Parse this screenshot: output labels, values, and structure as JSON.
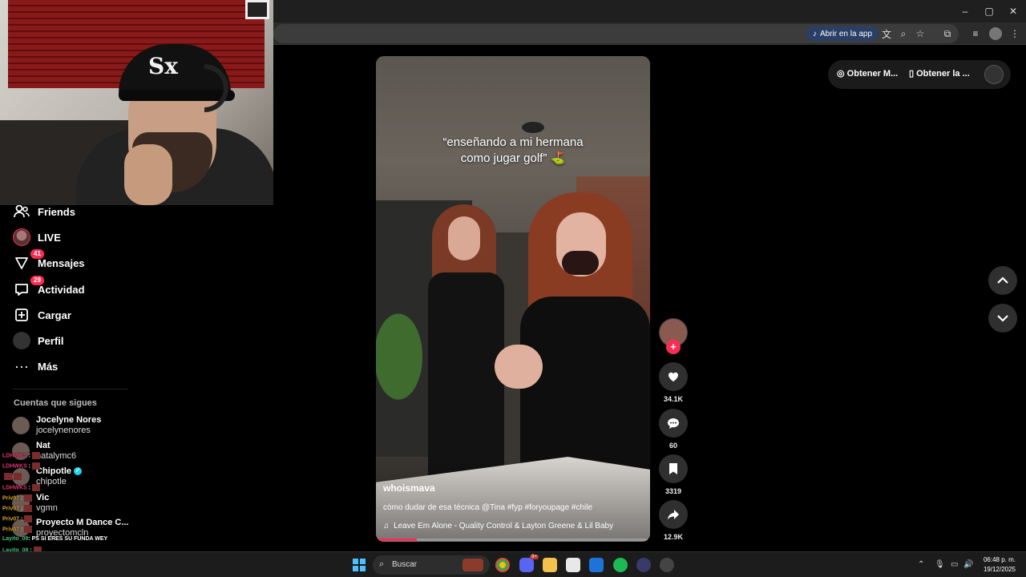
{
  "browser": {
    "open_app_label": "Abrir en la app",
    "window_controls": [
      "–",
      "▢",
      "✕"
    ]
  },
  "sidebar": {
    "items": [
      {
        "label": "Friends",
        "icon": "friends-icon"
      },
      {
        "label": "LIVE",
        "icon": "live-avatar"
      },
      {
        "label": "Mensajes",
        "icon": "messages-icon",
        "badge": "41"
      },
      {
        "label": "Actividad",
        "icon": "activity-icon",
        "badge": "29"
      },
      {
        "label": "Cargar",
        "icon": "upload-icon"
      },
      {
        "label": "Perfil",
        "icon": "profile-avatar"
      },
      {
        "label": "Más",
        "icon": "more-icon"
      }
    ],
    "following_title": "Cuentas que sigues",
    "accounts": [
      {
        "name": "Jocelyne Nores",
        "handle": "jocelynenores",
        "verified": false
      },
      {
        "name": "Nat",
        "handle": "natalymc6",
        "verified": false
      },
      {
        "name": "Chipotle",
        "handle": "chipotle",
        "verified": true
      },
      {
        "name": "Vic",
        "handle": "vgmn",
        "verified": false
      },
      {
        "name": "Proyecto M Dance C...",
        "handle": "proyectomcln",
        "verified": false
      }
    ]
  },
  "chat": [
    {
      "user": "LDHWKS",
      "text": ":",
      "color": "#e0356b"
    },
    {
      "user": "LDHWKS",
      "text": ":",
      "color": "#e0356b"
    },
    {
      "user": "",
      "text": "",
      "color": "#e0356b"
    },
    {
      "user": "LDHWKS",
      "text": ":",
      "color": "#e0356b"
    },
    {
      "user": "Priv07",
      "text": ":",
      "color": "#d6a021"
    },
    {
      "user": "Priv07",
      "text": ":",
      "color": "#d6a021"
    },
    {
      "user": "Priv07",
      "text": ":",
      "color": "#d6a021"
    },
    {
      "user": "Priv07",
      "text": ":",
      "color": "#d6a021"
    },
    {
      "user": "Layito_09",
      "text": ": PS SI ERES SU FUNDA WEY",
      "color": "#3ec47a"
    },
    {
      "user": "Layito_09",
      "text": ":",
      "color": "#3ec47a"
    },
    {
      "user": "Layito_09",
      "text": ":",
      "color": "#3ec47a"
    },
    {
      "user": "Layito_09",
      "text": ":",
      "color": "#3ec47a"
    }
  ],
  "video": {
    "caption_line1": "“enseñando a mi hermana",
    "caption_line2": "como jugar golf” ⛳",
    "author": "whoismava",
    "description": "cómo dudar de esa técnica @Tina #fyp #foryoupage #chile",
    "music": "Leave Em Alone - Quality Control & Layton Greene & Lil Baby",
    "progress": 0.15
  },
  "actions": {
    "likes": "34.1K",
    "comments": "60",
    "saves": "3319",
    "shares": "12.9K"
  },
  "top_right": {
    "btn1": "Obtener M...",
    "btn2": "Obtener la ..."
  },
  "taskbar": {
    "search_label": "Buscar",
    "time": "06:48 p. m.",
    "date": "19/12/2025",
    "discord_badge": "9+"
  }
}
